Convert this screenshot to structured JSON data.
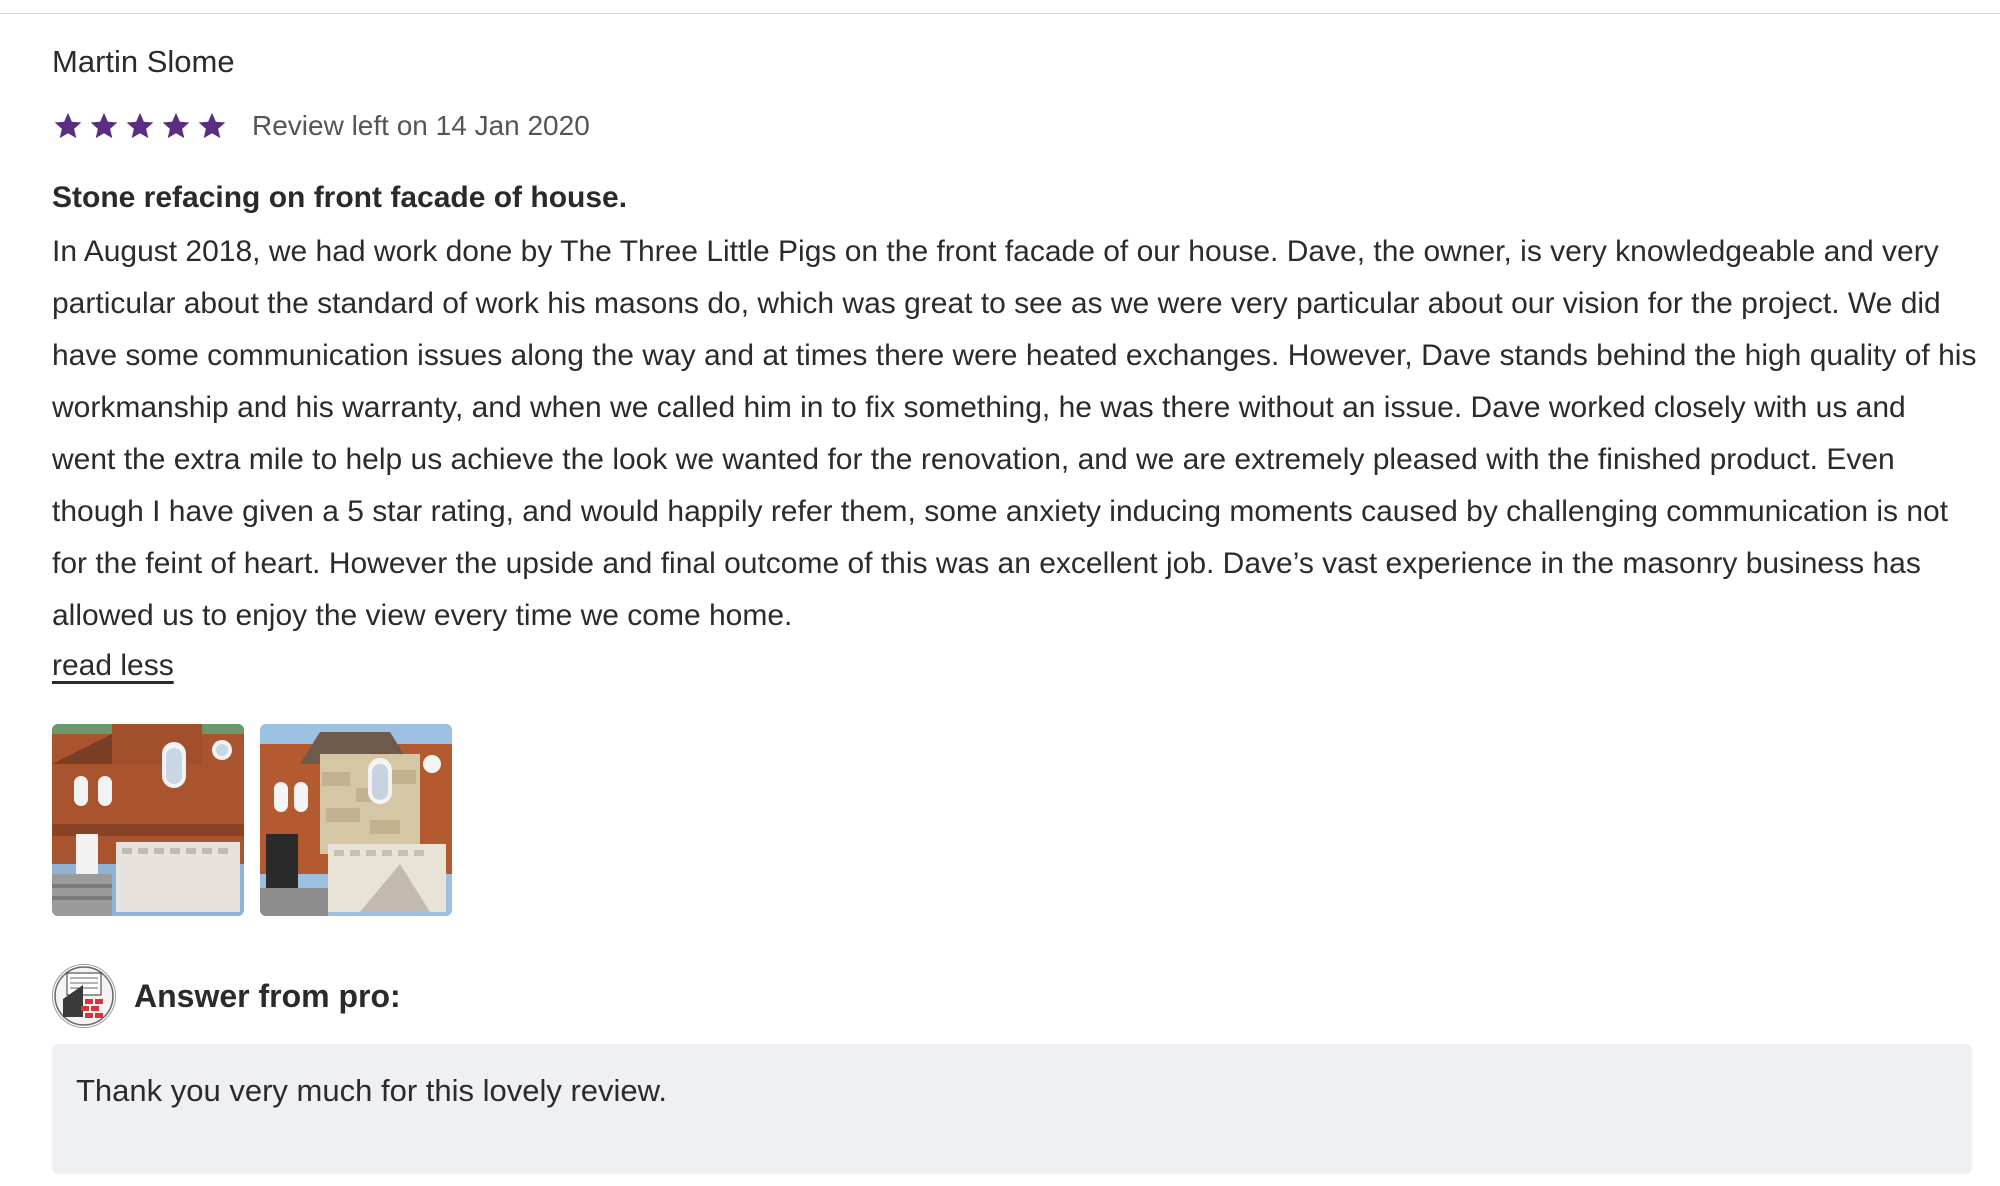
{
  "review": {
    "reviewer_name": "Martin Slome",
    "rating": 5,
    "rating_max": 5,
    "star_color": "#5a2d82",
    "date_text": "Review left on 14 Jan 2020",
    "title": "Stone refacing on front facade of house.",
    "body": "In August 2018, we had work done by The Three Little Pigs on the front facade of our house. Dave, the owner, is very knowledgeable and very particular about the standard of work his masons do, which was great to see as we were very particular about our vision for the project. We did have some communication issues along the way and at times there were heated exchanges. However, Dave stands behind the high quality of his workmanship and his warranty, and when we called him in to fix something, he was there without an issue. Dave worked closely with us and went the extra mile to help us achieve the look we wanted for the renovation, and we are extremely pleased with the finished product. Even though I have given a 5 star rating, and would happily refer them, some anxiety inducing moments caused by challenging communication is not for the feint of heart. However the upside and final outcome of this was an excellent job. Dave’s vast experience in the masonry business has allowed us to enjoy the view every time we come home.",
    "read_less_label": "read less",
    "photos": [
      {
        "icon": "house-photo-before"
      },
      {
        "icon": "house-photo-after"
      }
    ]
  },
  "answer": {
    "avatar_icon": "three-little-pigs-logo",
    "label": "Answer from pro:",
    "text": "Thank you very much for this lovely review."
  }
}
